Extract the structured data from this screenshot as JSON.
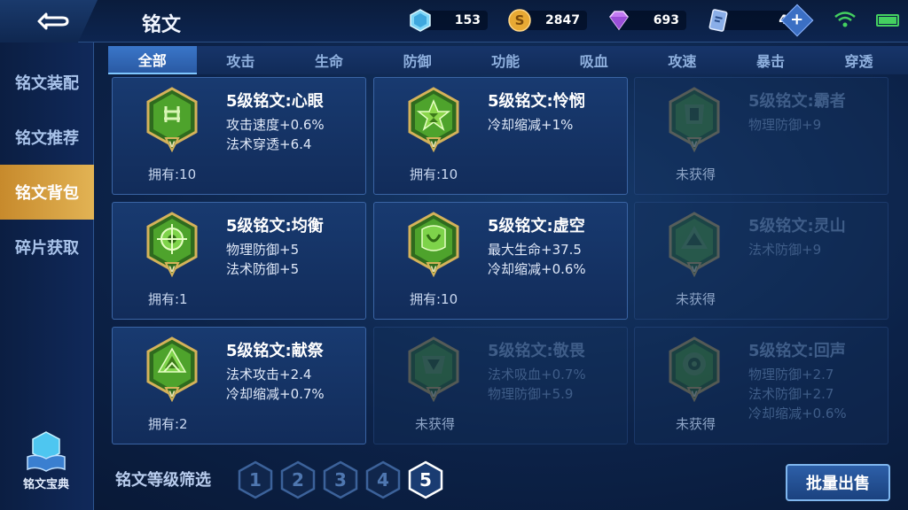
{
  "header": {
    "title": "铭文",
    "resources": [
      {
        "icon": "crystal-icon",
        "value": "153"
      },
      {
        "icon": "gold-coin-icon",
        "value": "2847"
      },
      {
        "icon": "diamond-icon",
        "value": "693"
      },
      {
        "icon": "ticket-icon",
        "value": "4"
      }
    ]
  },
  "sidebar": {
    "items": [
      {
        "label": "铭文装配",
        "active": false
      },
      {
        "label": "铭文推荐",
        "active": false
      },
      {
        "label": "铭文背包",
        "active": true
      },
      {
        "label": "碎片获取",
        "active": false
      }
    ],
    "codex_label": "铭文宝典"
  },
  "tabs": [
    "全部",
    "攻击",
    "生命",
    "防御",
    "功能",
    "吸血",
    "攻速",
    "暴击",
    "穿透"
  ],
  "active_tab": "全部",
  "cards": [
    {
      "name": "5级铭文:心眼",
      "stats": [
        "攻击速度+0.6%",
        "法术穿透+6.4"
      ],
      "footer": "拥有:10",
      "owned": true
    },
    {
      "name": "5级铭文:怜悯",
      "stats": [
        "冷却缩减+1%"
      ],
      "footer": "拥有:10",
      "owned": true
    },
    {
      "name": "5级铭文:霸者",
      "stats": [
        "物理防御+9"
      ],
      "footer": "未获得",
      "owned": false
    },
    {
      "name": "5级铭文:均衡",
      "stats": [
        "物理防御+5",
        "法术防御+5"
      ],
      "footer": "拥有:1",
      "owned": true
    },
    {
      "name": "5级铭文:虚空",
      "stats": [
        "最大生命+37.5",
        "冷却缩减+0.6%"
      ],
      "footer": "拥有:10",
      "owned": true
    },
    {
      "name": "5级铭文:灵山",
      "stats": [
        "法术防御+9"
      ],
      "footer": "未获得",
      "owned": false
    },
    {
      "name": "5级铭文:献祭",
      "stats": [
        "法术攻击+2.4",
        "冷却缩减+0.7%"
      ],
      "footer": "拥有:2",
      "owned": true
    },
    {
      "name": "5级铭文:敬畏",
      "stats": [
        "法术吸血+0.7%",
        "物理防御+5.9"
      ],
      "footer": "未获得",
      "owned": false
    },
    {
      "name": "5级铭文:回声",
      "stats": [
        "物理防御+2.7",
        "法术防御+2.7",
        "冷却缩减+0.6%"
      ],
      "footer": "未获得",
      "owned": false
    }
  ],
  "badge_mark": "V",
  "filter": {
    "label": "铭文等级筛选",
    "levels": [
      "1",
      "2",
      "3",
      "4",
      "5"
    ],
    "selected": "5"
  },
  "sell_button": "批量出售",
  "colors": {
    "accent_gold": "#e2b354",
    "badge_green": "#3f9a2e",
    "tab_active": "#3a76c9"
  }
}
